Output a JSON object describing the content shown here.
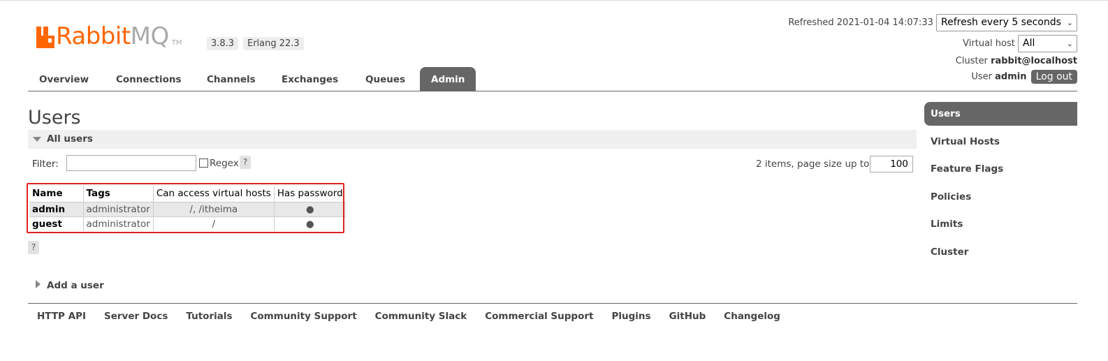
{
  "brand": {
    "name_orange": "Rabbit",
    "name_gray": "MQ",
    "tm": "TM",
    "version": "3.8.3",
    "erlang": "Erlang 22.3"
  },
  "header": {
    "refreshed_text": "Refreshed 2021-01-04 14:07:33",
    "refresh_select": "Refresh every 5 seconds",
    "virtual_host_label": "Virtual host",
    "virtual_host_select": "All",
    "cluster_label": "Cluster",
    "cluster_value": "rabbit@localhost",
    "user_label": "User",
    "user_value": "admin",
    "logout_label": "Log out"
  },
  "tabs": [
    "Overview",
    "Connections",
    "Channels",
    "Exchanges",
    "Queues",
    "Admin"
  ],
  "active_tab": "Admin",
  "page": {
    "title": "Users",
    "section_all_users": "All users",
    "filter_label": "Filter:",
    "filter_value": "",
    "regex_label": "Regex",
    "help": "?",
    "paging_text": "2 items, page size up to",
    "page_size": "100",
    "add_user": "Add a user"
  },
  "table": {
    "columns": [
      "Name",
      "Tags",
      "Can access virtual hosts",
      "Has password"
    ],
    "rows": [
      {
        "name": "admin",
        "tags": "administrator",
        "vhosts": "/, /itheima",
        "has_password": "●"
      },
      {
        "name": "guest",
        "tags": "administrator",
        "vhosts": "/",
        "has_password": "●"
      }
    ]
  },
  "sidebar": {
    "items": [
      "Users",
      "Virtual Hosts",
      "Feature Flags",
      "Policies",
      "Limits",
      "Cluster"
    ],
    "active": "Users"
  },
  "footer": {
    "links": [
      "HTTP API",
      "Server Docs",
      "Tutorials",
      "Community Support",
      "Community Slack",
      "Commercial Support",
      "Plugins",
      "GitHub",
      "Changelog"
    ]
  },
  "colors": {
    "brand_orange": "#ff6600",
    "active_tab": "#666666",
    "highlight_box": "#e02020"
  }
}
